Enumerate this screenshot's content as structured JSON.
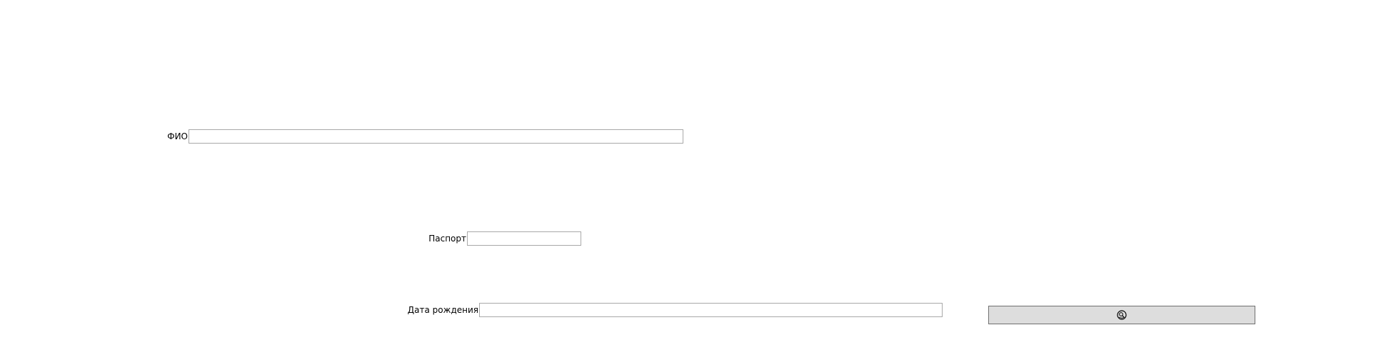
{
  "form": {
    "fio": {
      "label": "ФИО",
      "value": ""
    },
    "passport": {
      "label": "Паспорт",
      "value": ""
    },
    "birth_date": {
      "label": "Дата рождения",
      "value": ""
    },
    "submit_button": {
      "icon": "search-icon"
    }
  }
}
